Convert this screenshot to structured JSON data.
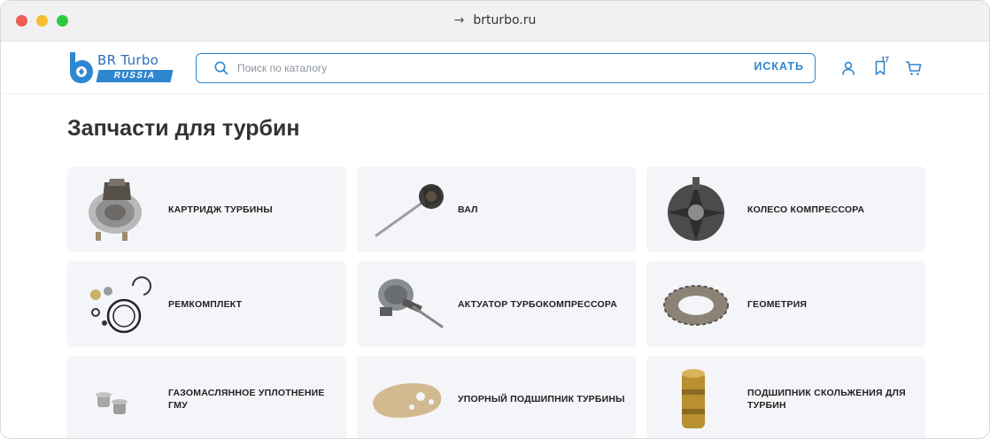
{
  "browser": {
    "url": "brturbo.ru",
    "nav_arrow": "→"
  },
  "header": {
    "logo_title": "BR Turbo",
    "logo_subtitle": "RUSSIA",
    "search": {
      "placeholder": "Поиск по каталогу",
      "value": "",
      "button_label": "ИСКАТЬ"
    },
    "favorites_count": "17",
    "icons": [
      "user-icon",
      "bookmark-icon",
      "cart-icon"
    ]
  },
  "main": {
    "title": "Запчасти для турбин",
    "categories": [
      {
        "label": "КАРТРИДЖ ТУРБИНЫ",
        "icon": "cartridge-image"
      },
      {
        "label": "ВАЛ",
        "icon": "shaft-image"
      },
      {
        "label": "КОЛЕСО КОМПРЕССОРА",
        "icon": "compressor-wheel-image"
      },
      {
        "label": "РЕМКОМПЛЕКТ",
        "icon": "repair-kit-image"
      },
      {
        "label": "АКТУАТОР ТУРБОКОМПРЕССОРА",
        "icon": "actuator-image"
      },
      {
        "label": "ГЕОМЕТРИЯ",
        "icon": "nozzle-ring-image"
      },
      {
        "label": "ГАЗОМАСЛЯННОЕ УПЛОТНЕНИЕ ГМУ",
        "icon": "seal-image"
      },
      {
        "label": "УПОРНЫЙ ПОДШИПНИК ТУРБИНЫ",
        "icon": "thrust-bearing-image"
      },
      {
        "label": "ПОДШИПНИК СКОЛЬЖЕНИЯ ДЛЯ ТУРБИН",
        "icon": "journal-bearing-image"
      }
    ]
  },
  "colors": {
    "accent": "#2f86d0",
    "card_bg": "#f3f5f8",
    "title": "#333333"
  }
}
